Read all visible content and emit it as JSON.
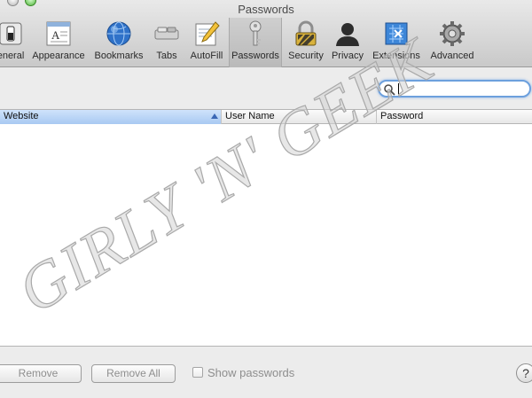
{
  "window": {
    "title": "Passwords"
  },
  "toolbar": {
    "items": [
      {
        "label": "eneral",
        "icon": "general-switch-icon"
      },
      {
        "label": "Appearance",
        "icon": "appearance-icon"
      },
      {
        "label": "Bookmarks",
        "icon": "bookmarks-globe-icon"
      },
      {
        "label": "Tabs",
        "icon": "tabs-icon"
      },
      {
        "label": "AutoFill",
        "icon": "autofill-pencil-icon"
      },
      {
        "label": "Passwords",
        "icon": "key-icon",
        "selected": true
      },
      {
        "label": "Security",
        "icon": "padlock-icon"
      },
      {
        "label": "Privacy",
        "icon": "privacy-person-icon"
      },
      {
        "label": "Extensions",
        "icon": "extensions-puzzle-icon"
      },
      {
        "label": "Advanced",
        "icon": "gear-icon"
      }
    ]
  },
  "search": {
    "value": "",
    "icon": "search-icon"
  },
  "table": {
    "columns": [
      "Website",
      "User Name",
      "Password"
    ],
    "sorted_column": "Website",
    "rows": []
  },
  "buttons": {
    "remove": "Remove",
    "remove_all": "Remove All"
  },
  "show_passwords": {
    "label": "Show passwords",
    "checked": false
  },
  "help": {
    "label": "?"
  },
  "watermark": {
    "text": "GIRLY 'N' GEEK"
  },
  "colors": {
    "accent": "#6da0dd",
    "sorted_header": "#a8c9f2",
    "watermark": "#cccccc"
  }
}
